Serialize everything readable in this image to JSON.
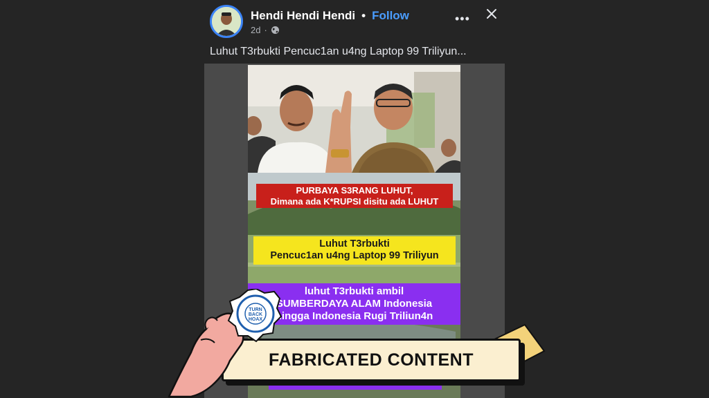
{
  "post": {
    "author_name": "Hendi Hendi Hendi",
    "separator": "•",
    "follow_label": "Follow",
    "time_ago": "2d",
    "meta_separator": "·",
    "more_icon": "more-icon",
    "close_icon": "close-icon",
    "audience_icon": "globe-icon",
    "caption": "Luhut T3rbukti Pencuc1an u4ng Laptop 99 Triliyun..."
  },
  "video_overlay": {
    "red_line1": "PURBAYA S3RANG LUHUT,",
    "red_line2": "Dimana ada K*RUPSI disitu ada LUHUT",
    "yellow_line1": "Luhut T3rbukti",
    "yellow_line2": "Pencuc1an u4ng Laptop 99 Triliyun",
    "purple_line1": "luhut T3rbukti ambil",
    "purple_line2": "SUMBERDAYA ALAM Indonesia",
    "purple_line3": "hingga Indonesia Rugi Triliun4n"
  },
  "stamp": {
    "label": "FABRICATED CONTENT",
    "seal_outer_text": "MASYARAKAT ANTI FITNAH INDONESIA",
    "seal_inner_line1": "TURN",
    "seal_inner_line2": "BACK",
    "seal_inner_line3": "HOAX",
    "seal_bottom": "MAFINDO"
  },
  "colors": {
    "background": "#252525",
    "accent_blue": "#4a9dff",
    "red_caption": "#c8201b",
    "yellow_caption": "#f5e51e",
    "purple_caption": "#8a2ff0",
    "banner": "#fbefd0",
    "hand": "#f2a9a0",
    "tape": "#f3d27a"
  }
}
